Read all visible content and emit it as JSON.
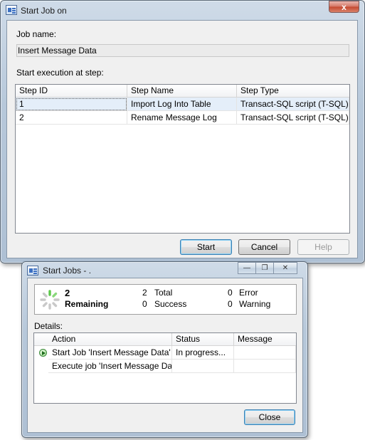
{
  "dialog": {
    "title": "Start Job on",
    "close_glyph": "x",
    "job_name_label": "Job name:",
    "job_name_value": "Insert Message Data",
    "start_step_label": "Start execution at step:",
    "columns": [
      "Step ID",
      "Step Name",
      "Step Type"
    ],
    "steps": [
      {
        "id": "1",
        "name": "Import Log Into Table",
        "type": "Transact-SQL script (T-SQL)",
        "selected": true
      },
      {
        "id": "2",
        "name": "Rename Message Log",
        "type": "Transact-SQL script (T-SQL)",
        "selected": false
      }
    ],
    "buttons": {
      "start": "Start",
      "cancel": "Cancel",
      "help": "Help"
    }
  },
  "progress": {
    "title": "Start Jobs - .",
    "remaining_count": "2",
    "remaining_label": "Remaining",
    "stats": {
      "total_value": "2",
      "total_label": "Total",
      "success_value": "0",
      "success_label": "Success",
      "error_value": "0",
      "error_label": "Error",
      "warning_value": "0",
      "warning_label": "Warning"
    },
    "details_label": "Details:",
    "columns": [
      "Action",
      "Status",
      "Message"
    ],
    "rows": [
      {
        "icon": "play-circle-icon",
        "action": "Start Job 'Insert Message Data'",
        "status": "In progress...",
        "message": ""
      },
      {
        "icon": "",
        "action": "Execute job 'Insert Message Da...",
        "status": "",
        "message": ""
      }
    ],
    "close_button": "Close",
    "caption_icons": [
      "minimize-icon",
      "restore-icon",
      "close-icon"
    ]
  },
  "colors": {
    "selection": "#e4eef9",
    "spinner_active": "#5cc94a",
    "spinner_idle": "#c9c9c9"
  }
}
